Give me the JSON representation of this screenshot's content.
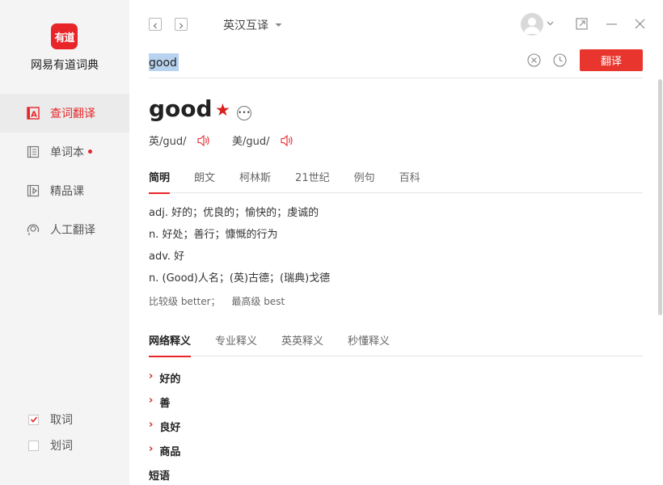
{
  "app": {
    "logo_text": "有道",
    "name": "网易有道词典"
  },
  "sidebar": {
    "items": [
      {
        "label": "查词翻译",
        "icon": "dictionary-icon",
        "active": true
      },
      {
        "label": "单词本",
        "icon": "wordbook-icon",
        "badge": true
      },
      {
        "label": "精品课",
        "icon": "course-icon"
      },
      {
        "label": "人工翻译",
        "icon": "human-translate-icon"
      }
    ],
    "options": [
      {
        "label": "取词",
        "checked": true
      },
      {
        "label": "划词",
        "checked": false
      }
    ]
  },
  "toolbar": {
    "language": "英汉互译"
  },
  "search": {
    "value": "good",
    "translate_label": "翻译"
  },
  "entry": {
    "word": "good",
    "phonetics": [
      {
        "label": "英/gud/"
      },
      {
        "label": "美/gud/"
      }
    ],
    "tabs": [
      "简明",
      "朗文",
      "柯林斯",
      "21世纪",
      "例句",
      "百科"
    ],
    "definitions": [
      "adj. 好的；优良的；愉快的；虔诚的",
      "n. 好处；善行；慷慨的行为",
      "adv. 好",
      "n. (Good)人名；(英)古德；(瑞典)戈德"
    ],
    "forms": [
      "比较级 better；",
      "最高级 best"
    ],
    "web_tabs": [
      "网络释义",
      "专业释义",
      "英英释义",
      "秒懂释义"
    ],
    "web_items": [
      "好的",
      "善",
      "良好",
      "商品"
    ],
    "phrases_title": "短语"
  },
  "colors": {
    "accent": "#e8262a",
    "button": "#e8362e",
    "sidebar_bg": "#f4f4f4"
  }
}
